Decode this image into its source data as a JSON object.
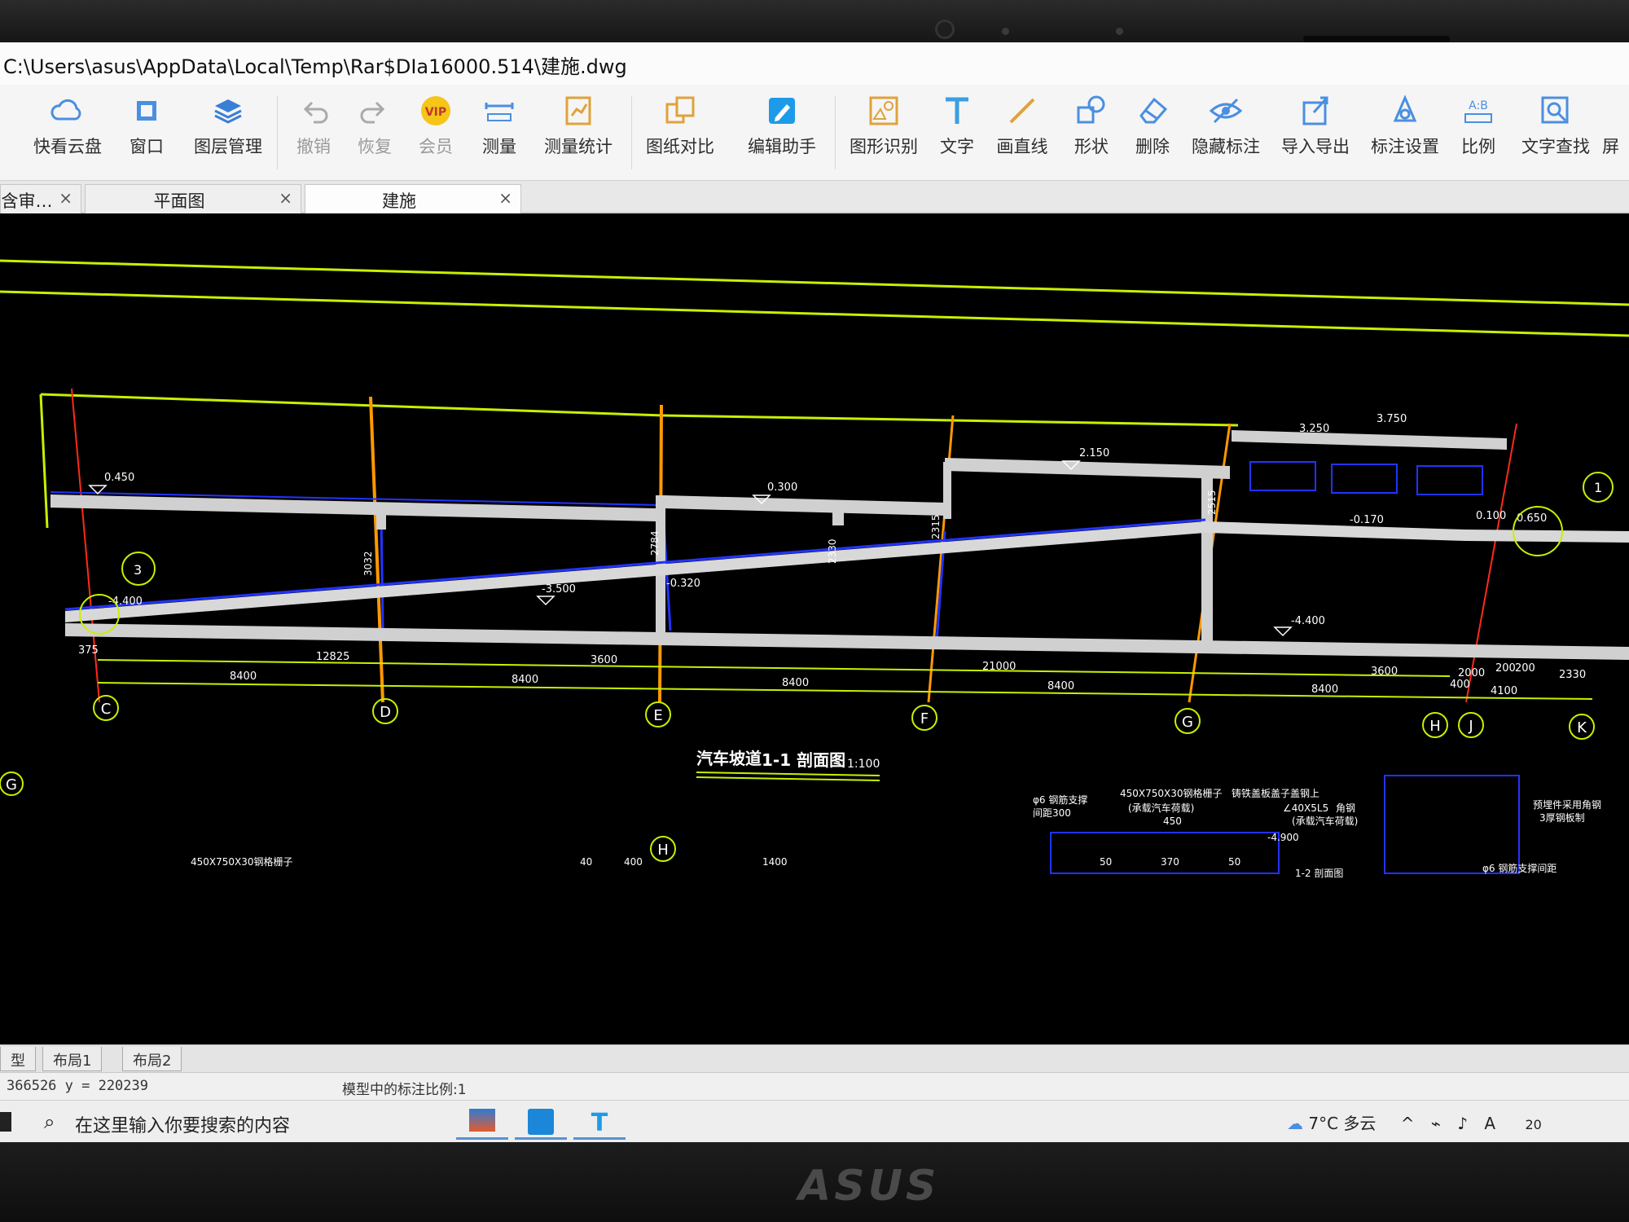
{
  "window": {
    "title": "C:\\Users\\asus\\AppData\\Local\\Temp\\Rar$DIa16000.514\\建施.dwg"
  },
  "toolbar": {
    "items": [
      {
        "label": "快看云盘",
        "icon": "cloud-icon"
      },
      {
        "label": "窗口",
        "icon": "window-icon"
      },
      {
        "label": "图层管理",
        "icon": "layers-icon"
      },
      {
        "label": "撤销",
        "icon": "undo-icon"
      },
      {
        "label": "恢复",
        "icon": "redo-icon"
      },
      {
        "label": "会员",
        "icon": "vip-icon"
      },
      {
        "label": "测量",
        "icon": "measure-icon"
      },
      {
        "label": "测量统计",
        "icon": "measure-stats-icon"
      },
      {
        "label": "图纸对比",
        "icon": "compare-icon"
      },
      {
        "label": "编辑助手",
        "icon": "edit-assistant-icon"
      },
      {
        "label": "图形识别",
        "icon": "shape-recognition-icon"
      },
      {
        "label": "文字",
        "icon": "text-icon"
      },
      {
        "label": "画直线",
        "icon": "line-icon"
      },
      {
        "label": "形状",
        "icon": "shape-icon"
      },
      {
        "label": "删除",
        "icon": "eraser-icon"
      },
      {
        "label": "隐藏标注",
        "icon": "hide-annotation-icon"
      },
      {
        "label": "导入导出",
        "icon": "import-export-icon"
      },
      {
        "label": "标注设置",
        "icon": "annotation-settings-icon"
      },
      {
        "label": "比例",
        "icon": "scale-icon"
      },
      {
        "label": "文字查找",
        "icon": "text-search-icon"
      },
      {
        "label": "屏"
      }
    ]
  },
  "tabs": [
    {
      "label": "含审…"
    },
    {
      "label": "平面图"
    },
    {
      "label": "建施"
    }
  ],
  "tab_close": "×",
  "drawing": {
    "title": "汽车坡道",
    "section": "1-1 剖面图",
    "scale": "1:100",
    "grid_labels": [
      "C",
      "D",
      "E",
      "F",
      "G",
      "H",
      "J",
      "K",
      "1",
      "3",
      "G",
      "H"
    ],
    "elevations": [
      "0.450",
      "0.300",
      "2.150",
      "3.250",
      "3.750",
      "-3.500",
      "-0.320",
      "-4.400",
      "-4.400",
      "-0.170",
      "0.100",
      "0.650"
    ],
    "heights": [
      "3032",
      "2784",
      "2330",
      "2315",
      "2515"
    ],
    "dims_top": [
      "375",
      "12825",
      "3600",
      "21000",
      "3600",
      "2000",
      "200",
      "200",
      "2330"
    ],
    "dims_bottom": [
      "8400",
      "8400",
      "8400",
      "8400",
      "8400",
      "400",
      "4100"
    ],
    "detail_notes": [
      "450X750X30钢格栅子",
      "(承载汽车荷载)",
      "450",
      "φ6 钢筋支撑",
      "间距300",
      "铸铁盖板盖子盖钢上",
      "∠40X5L5",
      "角钢",
      "(承载汽车荷载)",
      "-4.900",
      "370",
      "50",
      "50",
      "1-2 剖面图",
      "φ6 钢筋支撑间距",
      "预埋件采用角钢",
      "3厚钢板制",
      "450X750X30钢格栅子",
      "40",
      "400",
      "1400"
    ]
  },
  "layout_tabs": [
    "型",
    "布局1",
    "布局2"
  ],
  "status": {
    "coords": "366526  y = 220239",
    "scale_note": "模型中的标注比例:1"
  },
  "taskbar": {
    "search_placeholder": "在这里输入你要搜索的内容",
    "apps": [
      "explorer-app",
      "cad-app",
      "text-app"
    ],
    "weather": "7°C 多云",
    "time": "20"
  },
  "brand": "ASUS",
  "colors": {
    "green": "#c8f000",
    "blue": "#2233ff",
    "red": "#ff2a1a",
    "orange": "#ff9900",
    "slab": "#d0d0d0",
    "white": "#ffffff"
  }
}
